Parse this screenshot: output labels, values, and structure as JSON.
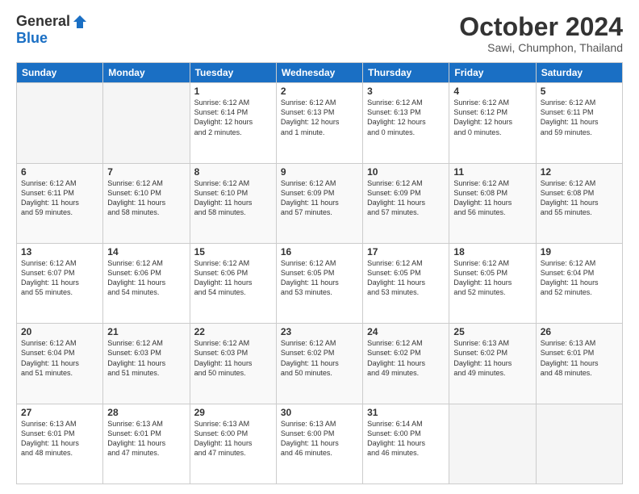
{
  "logo": {
    "general": "General",
    "blue": "Blue"
  },
  "title": "October 2024",
  "location": "Sawi, Chumphon, Thailand",
  "days_of_week": [
    "Sunday",
    "Monday",
    "Tuesday",
    "Wednesday",
    "Thursday",
    "Friday",
    "Saturday"
  ],
  "weeks": [
    [
      {
        "day": "",
        "info": ""
      },
      {
        "day": "",
        "info": ""
      },
      {
        "day": "1",
        "info": "Sunrise: 6:12 AM\nSunset: 6:14 PM\nDaylight: 12 hours\nand 2 minutes."
      },
      {
        "day": "2",
        "info": "Sunrise: 6:12 AM\nSunset: 6:13 PM\nDaylight: 12 hours\nand 1 minute."
      },
      {
        "day": "3",
        "info": "Sunrise: 6:12 AM\nSunset: 6:13 PM\nDaylight: 12 hours\nand 0 minutes."
      },
      {
        "day": "4",
        "info": "Sunrise: 6:12 AM\nSunset: 6:12 PM\nDaylight: 12 hours\nand 0 minutes."
      },
      {
        "day": "5",
        "info": "Sunrise: 6:12 AM\nSunset: 6:11 PM\nDaylight: 11 hours\nand 59 minutes."
      }
    ],
    [
      {
        "day": "6",
        "info": "Sunrise: 6:12 AM\nSunset: 6:11 PM\nDaylight: 11 hours\nand 59 minutes."
      },
      {
        "day": "7",
        "info": "Sunrise: 6:12 AM\nSunset: 6:10 PM\nDaylight: 11 hours\nand 58 minutes."
      },
      {
        "day": "8",
        "info": "Sunrise: 6:12 AM\nSunset: 6:10 PM\nDaylight: 11 hours\nand 58 minutes."
      },
      {
        "day": "9",
        "info": "Sunrise: 6:12 AM\nSunset: 6:09 PM\nDaylight: 11 hours\nand 57 minutes."
      },
      {
        "day": "10",
        "info": "Sunrise: 6:12 AM\nSunset: 6:09 PM\nDaylight: 11 hours\nand 57 minutes."
      },
      {
        "day": "11",
        "info": "Sunrise: 6:12 AM\nSunset: 6:08 PM\nDaylight: 11 hours\nand 56 minutes."
      },
      {
        "day": "12",
        "info": "Sunrise: 6:12 AM\nSunset: 6:08 PM\nDaylight: 11 hours\nand 55 minutes."
      }
    ],
    [
      {
        "day": "13",
        "info": "Sunrise: 6:12 AM\nSunset: 6:07 PM\nDaylight: 11 hours\nand 55 minutes."
      },
      {
        "day": "14",
        "info": "Sunrise: 6:12 AM\nSunset: 6:06 PM\nDaylight: 11 hours\nand 54 minutes."
      },
      {
        "day": "15",
        "info": "Sunrise: 6:12 AM\nSunset: 6:06 PM\nDaylight: 11 hours\nand 54 minutes."
      },
      {
        "day": "16",
        "info": "Sunrise: 6:12 AM\nSunset: 6:05 PM\nDaylight: 11 hours\nand 53 minutes."
      },
      {
        "day": "17",
        "info": "Sunrise: 6:12 AM\nSunset: 6:05 PM\nDaylight: 11 hours\nand 53 minutes."
      },
      {
        "day": "18",
        "info": "Sunrise: 6:12 AM\nSunset: 6:05 PM\nDaylight: 11 hours\nand 52 minutes."
      },
      {
        "day": "19",
        "info": "Sunrise: 6:12 AM\nSunset: 6:04 PM\nDaylight: 11 hours\nand 52 minutes."
      }
    ],
    [
      {
        "day": "20",
        "info": "Sunrise: 6:12 AM\nSunset: 6:04 PM\nDaylight: 11 hours\nand 51 minutes."
      },
      {
        "day": "21",
        "info": "Sunrise: 6:12 AM\nSunset: 6:03 PM\nDaylight: 11 hours\nand 51 minutes."
      },
      {
        "day": "22",
        "info": "Sunrise: 6:12 AM\nSunset: 6:03 PM\nDaylight: 11 hours\nand 50 minutes."
      },
      {
        "day": "23",
        "info": "Sunrise: 6:12 AM\nSunset: 6:02 PM\nDaylight: 11 hours\nand 50 minutes."
      },
      {
        "day": "24",
        "info": "Sunrise: 6:12 AM\nSunset: 6:02 PM\nDaylight: 11 hours\nand 49 minutes."
      },
      {
        "day": "25",
        "info": "Sunrise: 6:13 AM\nSunset: 6:02 PM\nDaylight: 11 hours\nand 49 minutes."
      },
      {
        "day": "26",
        "info": "Sunrise: 6:13 AM\nSunset: 6:01 PM\nDaylight: 11 hours\nand 48 minutes."
      }
    ],
    [
      {
        "day": "27",
        "info": "Sunrise: 6:13 AM\nSunset: 6:01 PM\nDaylight: 11 hours\nand 48 minutes."
      },
      {
        "day": "28",
        "info": "Sunrise: 6:13 AM\nSunset: 6:01 PM\nDaylight: 11 hours\nand 47 minutes."
      },
      {
        "day": "29",
        "info": "Sunrise: 6:13 AM\nSunset: 6:00 PM\nDaylight: 11 hours\nand 47 minutes."
      },
      {
        "day": "30",
        "info": "Sunrise: 6:13 AM\nSunset: 6:00 PM\nDaylight: 11 hours\nand 46 minutes."
      },
      {
        "day": "31",
        "info": "Sunrise: 6:14 AM\nSunset: 6:00 PM\nDaylight: 11 hours\nand 46 minutes."
      },
      {
        "day": "",
        "info": ""
      },
      {
        "day": "",
        "info": ""
      }
    ]
  ]
}
